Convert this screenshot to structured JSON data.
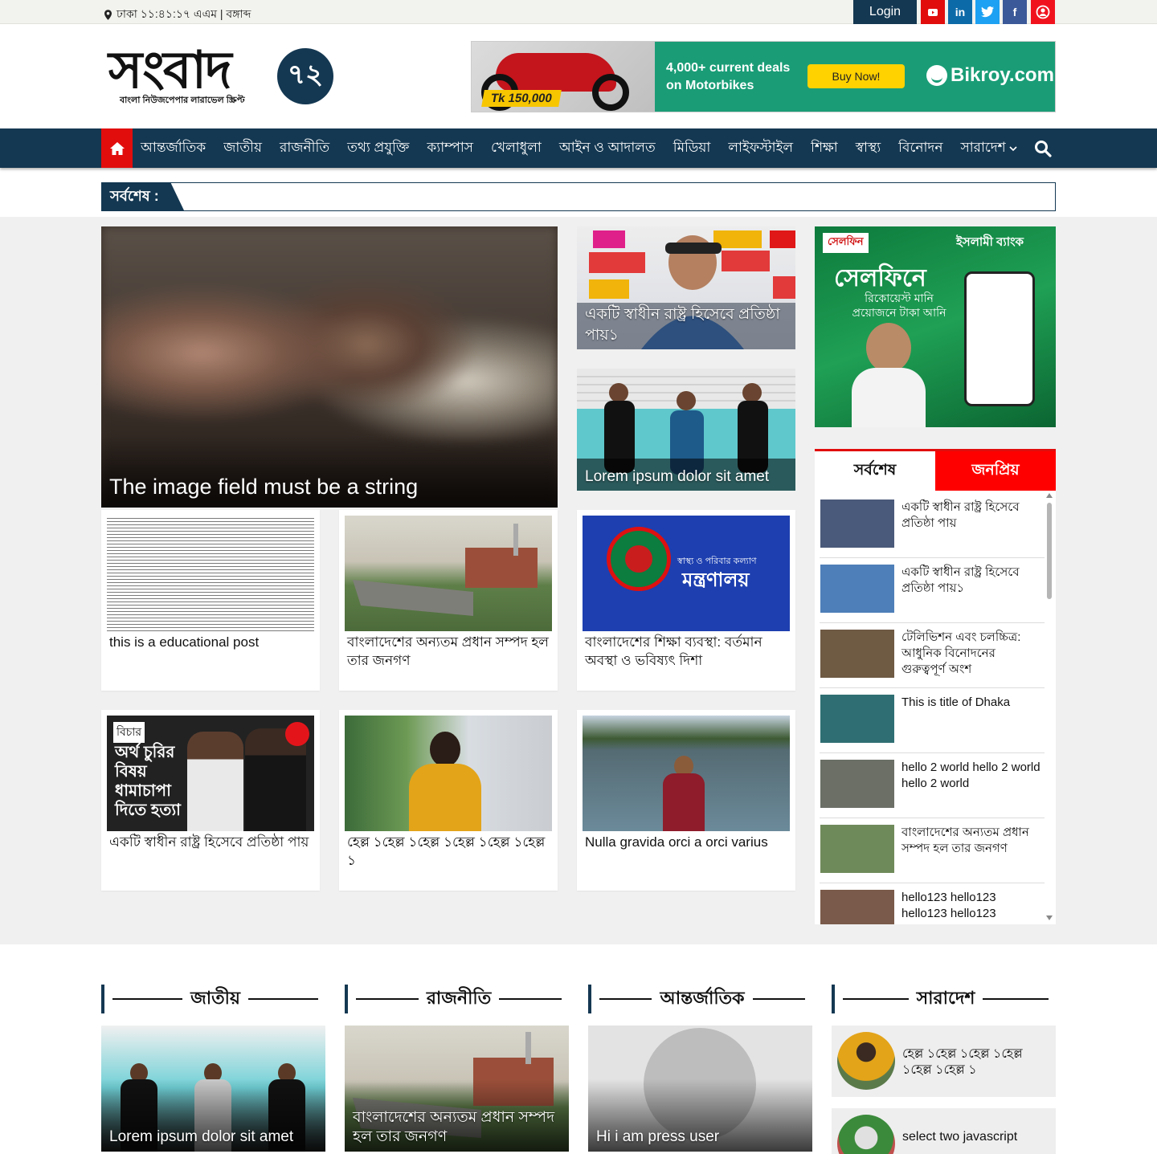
{
  "topbar": {
    "dateline": "ঢাকা ১১:৪১:১৭ এএম | বঙ্গাব্দ",
    "login": "Login",
    "social": [
      "youtube-icon",
      "linkedin-icon",
      "twitter-icon",
      "facebook-icon",
      "user-icon"
    ]
  },
  "logo": {
    "text": "সংবাদ",
    "ring": "৭২",
    "tagline": "বাংলা নিউজপেপার লারাভেল স্ক্রিপ্ট"
  },
  "banner": {
    "price": "Tk 150,000",
    "deal_line1": "4,000+ current deals",
    "deal_line2": "on Motorbikes",
    "buy": "Buy Now!",
    "brand": "Bikroy.com"
  },
  "nav": {
    "items": [
      "আন্তর্জাতিক",
      "জাতীয়",
      "রাজনীতি",
      "তথ্য প্রযুক্তি",
      "ক্যাম্পাস",
      "খেলাধুলা",
      "আইন ও আদালত",
      "মিডিয়া",
      "লাইফস্টাইল",
      "শিক্ষা",
      "স্বাস্থ্য",
      "বিনোদন",
      "সারাদেশ"
    ]
  },
  "breaking": {
    "label": "সর্বশেষ :"
  },
  "lead": {
    "title": "The image field must be a string"
  },
  "side_cards": [
    {
      "title": "একটি স্বাধীন রাষ্ট্র হিসেবে প্রতিষ্ঠা পায়১"
    },
    {
      "title": "Lorem ipsum dolor sit amet"
    }
  ],
  "ad_side": {
    "brand": "সেলফিন",
    "bank": "ইসলামী ব্যাংক",
    "head": "সেলফিনে",
    "sub": "রিকোয়েস্ট মানি প্রয়োজনে টাকা আনি"
  },
  "cards": [
    {
      "title": "this is a educational post"
    },
    {
      "title": "বাংলাদেশের অন্যতম প্রধান সম্পদ হল তার জনগণ"
    },
    {
      "title": "বাংলাদেশের শিক্ষা ব্যবস্থা: বর্তমান অবস্থা ও ভবিষ্যৎ দিশা",
      "thumb_line1": "স্বাস্থ্য ও পরিবার কল্যাণ",
      "thumb_line2": "মন্ত্রণালয়"
    },
    {
      "title": "একটি স্বাধীন রাষ্ট্র হিসেবে প্রতিষ্ঠা পায়",
      "thumb_tag": "বিচার",
      "thumb_text": "অর্থ চুরির বিষয় ধামাচাপা দিতে হত্যা"
    },
    {
      "title": "হেল্ল ১হেল্ল ১হেল্ল ১হেল্ল ১হেল্ল ১হেল্ল ১"
    },
    {
      "title": "Nulla gravida orci a orci varius"
    }
  ],
  "tabs": {
    "latest": "সর্বশেষ",
    "popular": "জনপ্রিয়",
    "list": [
      {
        "title": "একটি স্বাধীন রাষ্ট্র হিসেবে প্রতিষ্ঠা পায়",
        "color": "#4a5a7a"
      },
      {
        "title": "একটি স্বাধীন রাষ্ট্র হিসেবে প্রতিষ্ঠা পায়১",
        "color": "#4e7fb8"
      },
      {
        "title": "টেলিভিশন এবং চলচ্চিত্র: আধুনিক বিনোদনের গুরুত্বপূর্ণ অংশ",
        "color": "#6f5a44"
      },
      {
        "title": "This is title of Dhaka",
        "color": "#2f6f73"
      },
      {
        "title": "hello 2 world hello 2 world hello 2 world",
        "color": "#6b6f66"
      },
      {
        "title": "বাংলাদেশের অন্যতম প্রধান সম্পদ হল তার জনগণ",
        "color": "#6f8a5a"
      },
      {
        "title": "hello123 hello123 hello123 hello123",
        "color": "#7a5a4a"
      }
    ]
  },
  "sections": [
    {
      "heading": "জাতীয়",
      "title": "Lorem ipsum dolor sit amet"
    },
    {
      "heading": "রাজনীতি",
      "title": "বাংলাদেশের অন্যতম প্রধান সম্পদ হল তার জনগণ"
    },
    {
      "heading": "আন্তর্জাতিক",
      "title": "Hi i am press user"
    },
    {
      "heading": "সারাদেশ",
      "items": [
        "হেল্ল ১হেল্ল ১হেল্ল ১হেল্ল ১হেল্ল ১হেল্ল ১",
        "select two javascript"
      ]
    }
  ]
}
